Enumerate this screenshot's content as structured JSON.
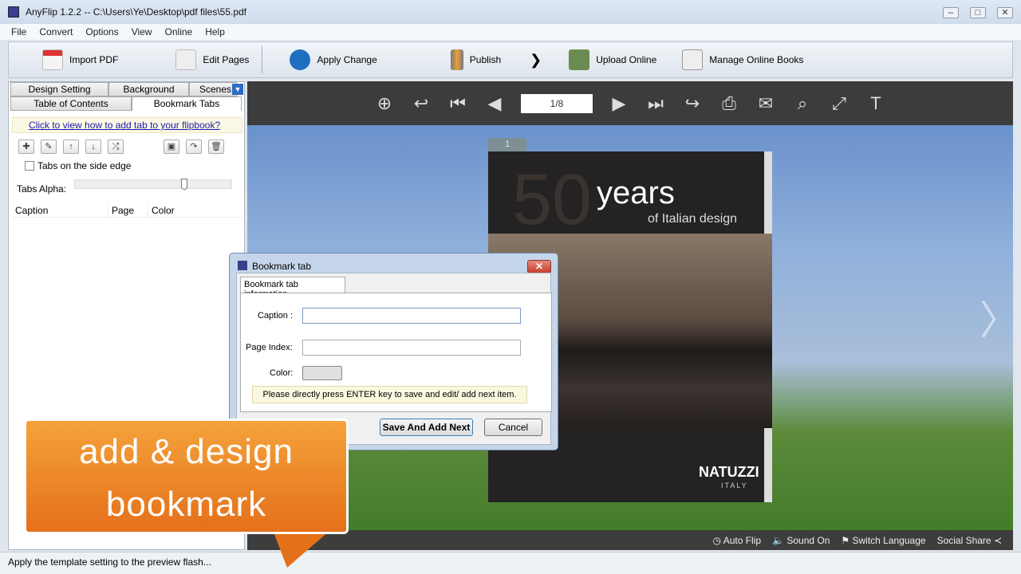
{
  "window": {
    "title": "AnyFlip 1.2.2  -- C:\\Users\\Ye\\Desktop\\pdf files\\55.pdf"
  },
  "menu": [
    "File",
    "Convert",
    "Options",
    "View",
    "Online",
    "Help"
  ],
  "toolbar": {
    "import_pdf": "Import PDF",
    "edit_pages": "Edit Pages",
    "apply_change": "Apply Change",
    "publish": "Publish",
    "upload_online": "Upload Online",
    "manage_online_books": "Manage Online Books"
  },
  "left_panel": {
    "tabs_row1": [
      "Design Setting",
      "Background",
      "Scenes"
    ],
    "tabs_row2": [
      "Table of Contents",
      "Bookmark Tabs"
    ],
    "hint_link": "Click to view how to add tab to your flipbook?",
    "side_edge_label": "Tabs on the side edge",
    "side_edge_checked": false,
    "alpha_label": "Tabs Alpha:",
    "alpha_value": 0.7,
    "columns": [
      "Caption",
      "Page",
      "Color"
    ]
  },
  "preview": {
    "page_indicator": "1/8",
    "page_tab": "1",
    "book": {
      "headline": "years",
      "subhead": "of Italian design",
      "big_number": "50",
      "brand": "NATUZZI",
      "brand_sub": "ITALY"
    },
    "bottom": {
      "auto_flip": "Auto Flip",
      "sound_on": "Sound On",
      "switch_language": "Switch Language",
      "social_share": "Social Share"
    }
  },
  "dialog": {
    "title": "Bookmark tab",
    "tab": "Bookmark tab information",
    "caption_label": "Caption :",
    "caption_value": "",
    "page_index_label": "Page Index:",
    "page_index_value": "",
    "color_label": "Color:",
    "color_value": "#e0e0e0",
    "note": "Please directly press ENTER key to save and edit/ add next item.",
    "save_button": "Save And Add Next",
    "cancel_button": "Cancel"
  },
  "callout": {
    "line1": "add & design",
    "line2": "bookmark"
  },
  "status": "Apply the template setting to the preview flash..."
}
